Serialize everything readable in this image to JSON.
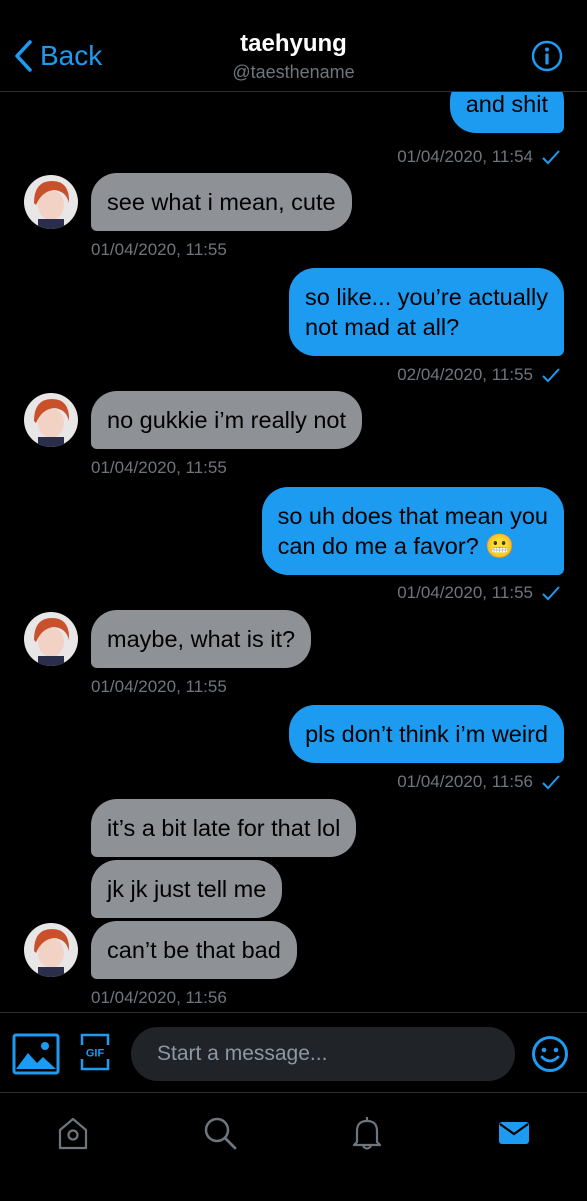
{
  "header": {
    "back_label": "Back",
    "title": "taehyung",
    "handle": "@taesthename"
  },
  "messages": [
    {
      "sender": "me",
      "text": "and shit"
    },
    {
      "sender": "me",
      "timestamp": "01/04/2020, 11:54",
      "status": "sent"
    },
    {
      "sender": "taehyung",
      "text": "see what i mean, cute",
      "timestamp": "01/04/2020, 11:55"
    },
    {
      "sender": "me",
      "lines": [
        "so like... you’re actually",
        "not mad at all?"
      ],
      "timestamp": "02/04/2020, 11:55",
      "status": "sent"
    },
    {
      "sender": "taehyung",
      "text": "no gukkie i’m really not",
      "timestamp": "01/04/2020, 11:55"
    },
    {
      "sender": "me",
      "lines": [
        "so uh does that mean you",
        "can do me a favor? 😬"
      ],
      "timestamp": "01/04/2020, 11:55",
      "status": "sent"
    },
    {
      "sender": "taehyung",
      "text": "maybe, what is it?",
      "timestamp": "01/04/2020, 11:55"
    },
    {
      "sender": "me",
      "text": "pls don’t think i’m weird",
      "timestamp": "01/04/2020, 11:56",
      "status": "sent"
    },
    {
      "sender": "taehyung",
      "text": "it’s a bit late for that lol"
    },
    {
      "sender": "taehyung",
      "text": "jk jk just tell me"
    },
    {
      "sender": "taehyung",
      "text": "can’t be that bad",
      "timestamp": "01/04/2020, 11:56"
    }
  ],
  "composer": {
    "placeholder": "Start a message...",
    "gif_label": "GIF"
  },
  "tabs": [
    {
      "name": "home",
      "icon": "home-icon"
    },
    {
      "name": "search",
      "icon": "search-icon"
    },
    {
      "name": "notifications",
      "icon": "bell-icon"
    },
    {
      "name": "messages",
      "icon": "mail-icon",
      "active": true
    }
  ],
  "colors": {
    "accent": "#1d9bf0",
    "incoming_bubble": "#8e9297",
    "timestamp": "#6e767d",
    "background": "#000000"
  }
}
